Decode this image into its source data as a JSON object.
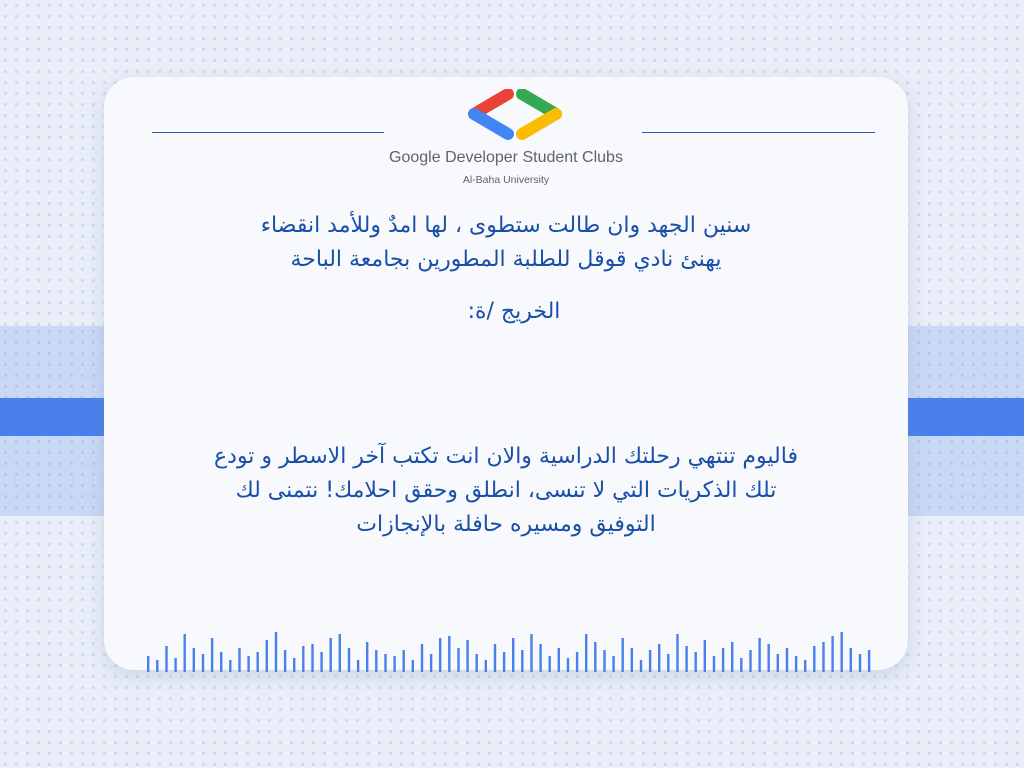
{
  "brand": {
    "name": "Google Developer Student Clubs",
    "university": "Al-Baha University"
  },
  "text": {
    "intro_line1": "سنين الجهد وان طالت ستطوى ، لها امدٌ وللأمد انقضاء",
    "intro_line2": "يهنئ نادي قوقل للطلبة المطورين بجامعة الباحة",
    "graduate": "الخريج /ة:",
    "message_line1": "فاليوم تنتهي رحلتك الدراسية والان انت تكتب آخر الاسطر و تودع",
    "message_line2": "تلك الذكريات التي لا تنسى، انطلق وحقق احلامك! نتمنى لك",
    "message_line3": "التوفيق ومسيره حافلة بالإنجازات"
  },
  "colors": {
    "text_blue": "#1a4fa8",
    "accent_blue": "#4a80ec",
    "logo_red": "#ea4335",
    "logo_blue": "#4285f4",
    "logo_green": "#34a853",
    "logo_yellow": "#fbbc04"
  },
  "decorations": {
    "wave_levels": [
      0.4,
      0.3,
      0.65,
      0.35,
      0.95,
      0.6,
      0.45,
      0.85,
      0.5,
      0.3,
      0.6,
      0.4,
      0.5,
      0.8,
      1.0,
      0.55,
      0.35,
      0.65,
      0.7,
      0.5,
      0.85,
      0.95,
      0.6,
      0.3,
      0.75,
      0.55,
      0.45,
      0.4,
      0.55,
      0.3,
      0.7,
      0.45,
      0.85,
      0.9,
      0.6,
      0.8,
      0.45,
      0.3,
      0.7,
      0.5,
      0.85,
      0.55,
      0.95,
      0.7,
      0.4,
      0.6,
      0.35,
      0.5,
      0.95,
      0.75,
      0.55,
      0.4,
      0.85,
      0.6,
      0.3,
      0.55,
      0.7,
      0.45,
      0.95,
      0.65,
      0.5,
      0.8,
      0.4,
      0.6,
      0.75,
      0.35,
      0.55,
      0.85,
      0.7,
      0.45,
      0.6,
      0.4,
      0.3,
      0.65,
      0.75,
      0.9,
      1.0,
      0.6,
      0.45,
      0.55
    ]
  }
}
